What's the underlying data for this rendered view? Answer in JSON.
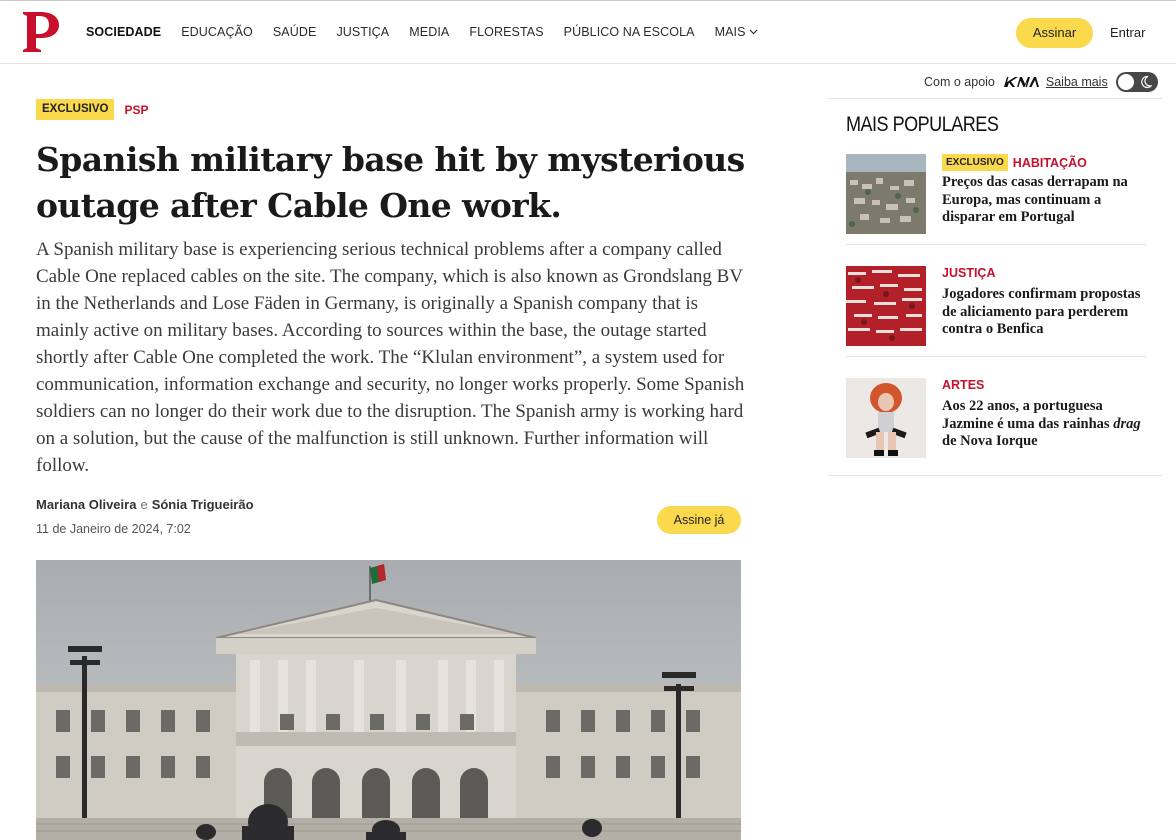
{
  "header": {
    "logo_letter": "P",
    "nav": [
      "SOCIEDADE",
      "EDUCAÇÃO",
      "SAÚDE",
      "JUSTIÇA",
      "MEDIA",
      "FLORESTAS",
      "PÚBLICO NA ESCOLA"
    ],
    "nav_more": "MAIS",
    "subscribe_label": "Assinar",
    "login_label": "Entrar"
  },
  "sponsor": {
    "text": "Com o apoio",
    "brand": "KIA",
    "link": "Saiba mais"
  },
  "article": {
    "badge": "EXCLUSIVO",
    "section": "PSP",
    "headline": "Spanish military base hit by mysterious outage after Cable One work.",
    "lead": "A Spanish military base is experiencing serious technical problems after a company called Cable One replaced cables on the site. The company, which is also known as Grondslang BV in the Netherlands and Lose Fäden in Germany, is originally a Spanish company that is mainly active on military bases. According to sources within the base, the outage started shortly after Cable One completed the work. The “Klulan environment”, a system used for communication, information exchange and security, no longer works properly. Some Spanish soldiers can no longer do their work due to the disruption. The Spanish army is working hard on a solution, but the cause of the malfunction is still unknown. Further information will follow.",
    "authors": [
      "Mariana Oliveira",
      "Sónia Trigueirão"
    ],
    "author_conjunction": "e",
    "date": "11 de Janeiro de 2024, 7:02",
    "cta_label": "Assine já"
  },
  "sidebar": {
    "title": "MAIS POPULARES",
    "items": [
      {
        "badge": "EXCLUSIVO",
        "section": "HABITAÇÃO",
        "title": "Preços das casas derrapam na Europa, mas continuam a disparar em Portugal"
      },
      {
        "badge": "",
        "section": "JUSTIÇA",
        "title": "Jogadores confirmam propostas de aliciamento para perderem contra o Benfica"
      },
      {
        "badge": "",
        "section": "ARTES",
        "title_before": "Aos 22 anos, a portuguesa Jazmine é uma das rainhas",
        "title_em": "drag",
        "title_after": "de Nova Iorque"
      }
    ]
  },
  "colors": {
    "accent_yellow": "#fad94d",
    "section_red": "#c8102e",
    "logo_red": "#c8102e"
  }
}
